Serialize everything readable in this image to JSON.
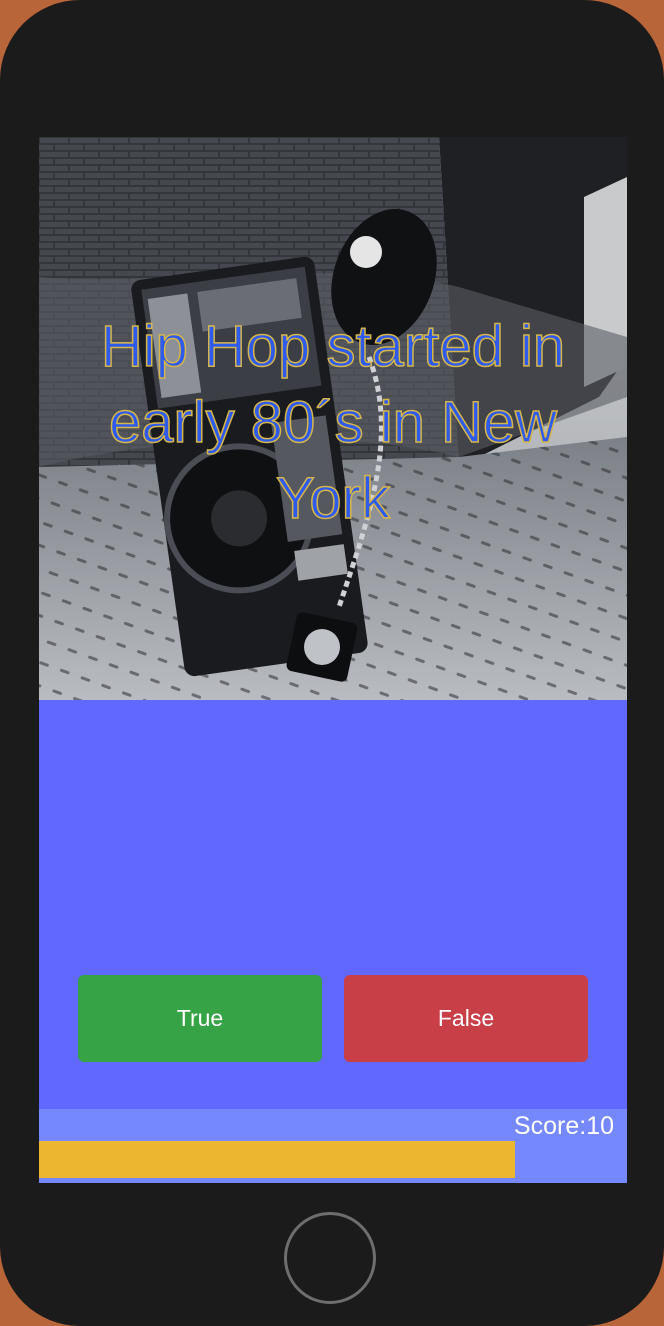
{
  "question": {
    "text": "Hip Hop started in early 80´s in New York",
    "image": "boombox-street-photo"
  },
  "buttons": {
    "true_label": "True",
    "false_label": "False"
  },
  "footer": {
    "score_label": "Score:",
    "score_value": "10",
    "progress_fraction": 0.81
  },
  "colors": {
    "screen_bg": "#6168fe",
    "footer_bg": "#7588fe",
    "true_button": "#37a347",
    "false_button": "#c93f48",
    "progress_fill": "#ecb630",
    "question_text": "#2f5bea"
  }
}
